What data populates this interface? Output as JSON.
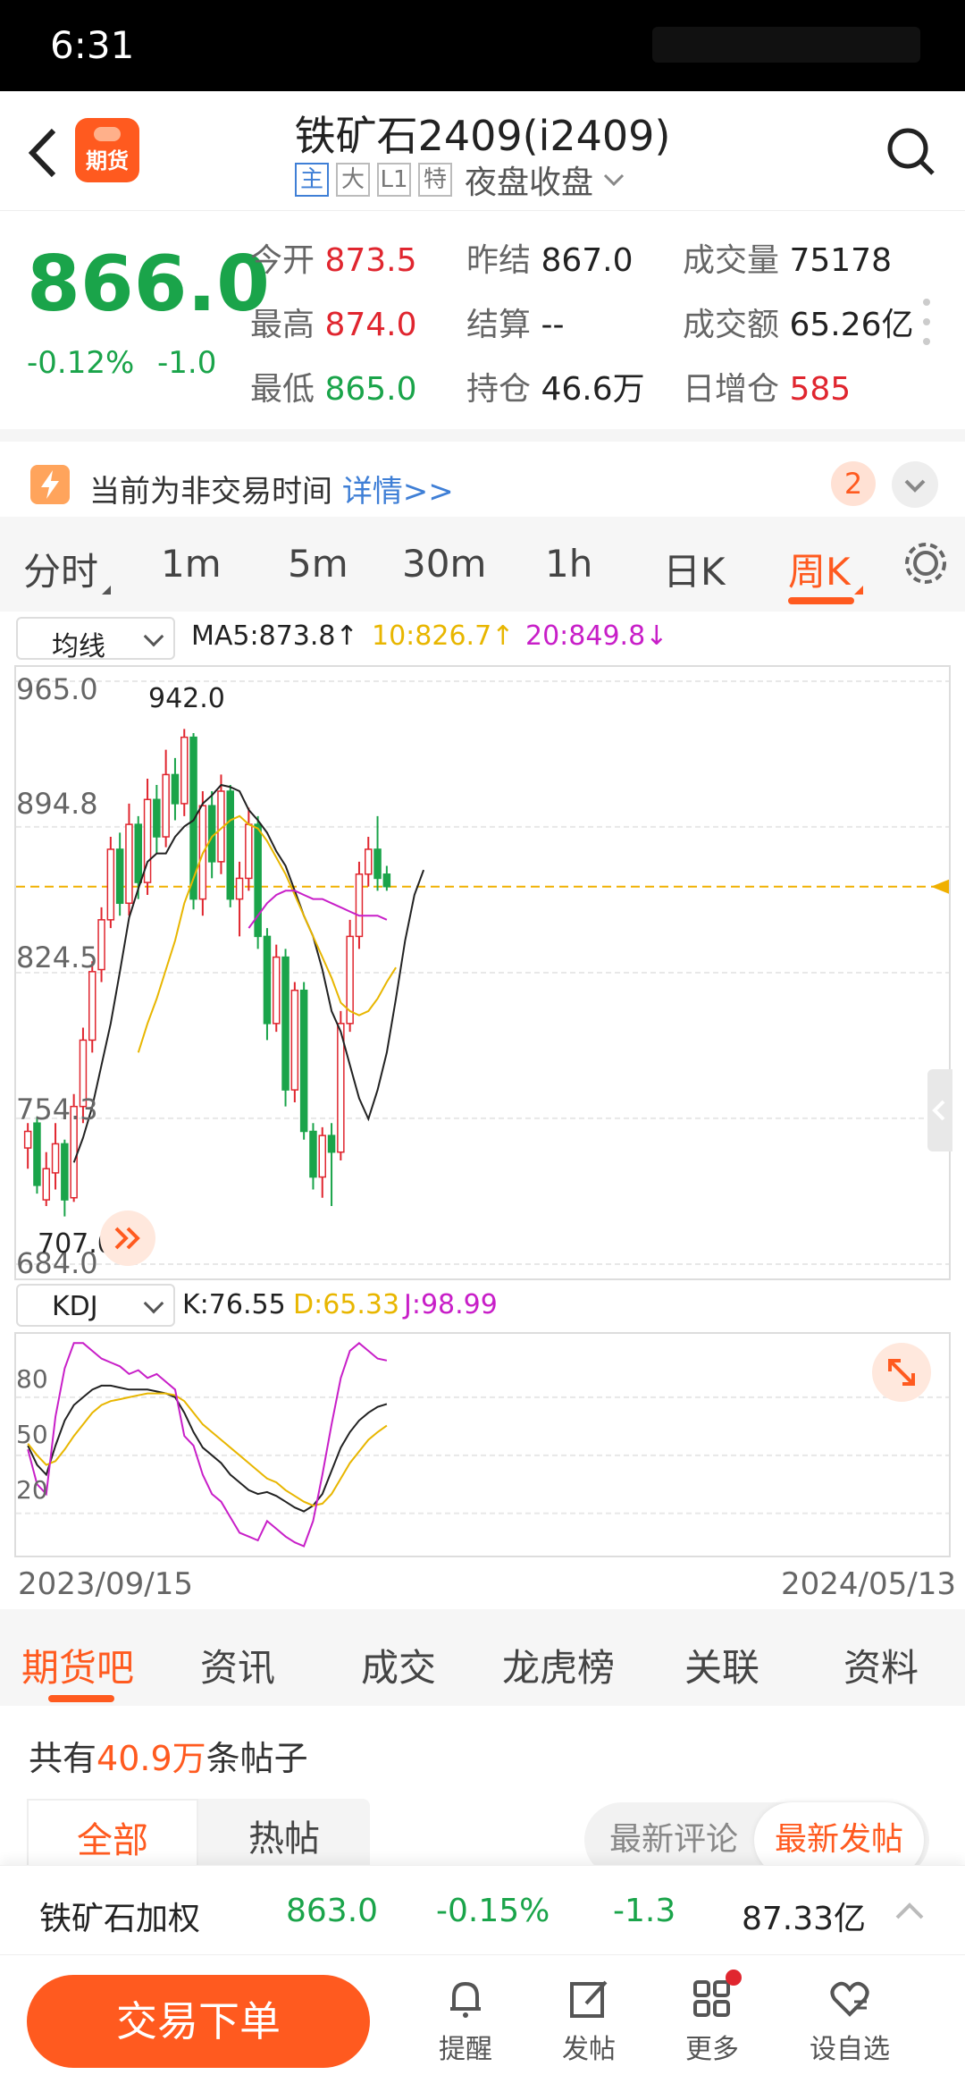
{
  "status": {
    "time": "6:31"
  },
  "header": {
    "logo_text": "期货",
    "title": "铁矿石2409(i2409)",
    "tags": [
      "主",
      "大",
      "L1",
      "特"
    ],
    "session": "夜盘收盘"
  },
  "quote": {
    "last": "866.0",
    "change_pct": "-0.12%",
    "change": "-1.0",
    "cells": [
      {
        "label": "今开",
        "value": "873.5",
        "color": "red"
      },
      {
        "label": "昨结",
        "value": "867.0",
        "color": "dark"
      },
      {
        "label": "成交量",
        "value": "75178",
        "color": "dark"
      },
      {
        "label": "最高",
        "value": "874.0",
        "color": "red"
      },
      {
        "label": "结算",
        "value": "--",
        "color": "dark"
      },
      {
        "label": "成交额",
        "value": "65.26亿",
        "color": "dark"
      },
      {
        "label": "最低",
        "value": "865.0",
        "color": "green"
      },
      {
        "label": "持仓",
        "value": "46.6万",
        "color": "dark"
      },
      {
        "label": "日增仓",
        "value": "585",
        "color": "red"
      }
    ]
  },
  "notice": {
    "text": "当前为非交易时间",
    "link": "详情>>",
    "badge": "2"
  },
  "period_tabs": [
    "分时",
    "1m",
    "5m",
    "30m",
    "1h",
    "日K",
    "周K"
  ],
  "active_period": "周K",
  "ma": {
    "selector": "均线",
    "ma5": "MA5:873.8↑",
    "ma10": "10:826.7↑",
    "ma20": "20:849.8↓",
    "colors": {
      "ma5": "#222222",
      "ma10": "#e8b600",
      "ma20": "#c81fc8"
    }
  },
  "chart_data": [
    {
      "type": "candlestick",
      "title": "",
      "ylim": [
        684.0,
        965.0
      ],
      "y_ticks": [
        "965.0",
        "894.8",
        "824.5",
        "754.3",
        "684.0"
      ],
      "high_label": "942.0",
      "low_label": "707.0",
      "current_price_line": 866.0,
      "candles": [
        {
          "o": 740,
          "c": 748,
          "h": 752,
          "l": 730
        },
        {
          "o": 752,
          "c": 722,
          "h": 755,
          "l": 718
        },
        {
          "o": 715,
          "c": 730,
          "h": 738,
          "l": 712
        },
        {
          "o": 728,
          "c": 742,
          "h": 752,
          "l": 720
        },
        {
          "o": 742,
          "c": 715,
          "h": 744,
          "l": 707
        },
        {
          "o": 716,
          "c": 760,
          "h": 766,
          "l": 714
        },
        {
          "o": 760,
          "c": 792,
          "h": 798,
          "l": 752
        },
        {
          "o": 792,
          "c": 825,
          "h": 830,
          "l": 786
        },
        {
          "o": 826,
          "c": 850,
          "h": 856,
          "l": 820
        },
        {
          "o": 850,
          "c": 884,
          "h": 890,
          "l": 846
        },
        {
          "o": 884,
          "c": 858,
          "h": 892,
          "l": 852
        },
        {
          "o": 858,
          "c": 896,
          "h": 906,
          "l": 852
        },
        {
          "o": 896,
          "c": 868,
          "h": 900,
          "l": 860
        },
        {
          "o": 868,
          "c": 908,
          "h": 918,
          "l": 862
        },
        {
          "o": 908,
          "c": 890,
          "h": 915,
          "l": 882
        },
        {
          "o": 890,
          "c": 920,
          "h": 932,
          "l": 885
        },
        {
          "o": 920,
          "c": 906,
          "h": 928,
          "l": 898
        },
        {
          "o": 906,
          "c": 938,
          "h": 942,
          "l": 900
        },
        {
          "o": 938,
          "c": 860,
          "h": 940,
          "l": 855
        },
        {
          "o": 860,
          "c": 905,
          "h": 912,
          "l": 852
        },
        {
          "o": 905,
          "c": 878,
          "h": 912,
          "l": 870
        },
        {
          "o": 878,
          "c": 912,
          "h": 920,
          "l": 872
        },
        {
          "o": 912,
          "c": 860,
          "h": 915,
          "l": 856
        },
        {
          "o": 860,
          "c": 870,
          "h": 878,
          "l": 842
        },
        {
          "o": 870,
          "c": 896,
          "h": 904,
          "l": 864
        },
        {
          "o": 896,
          "c": 842,
          "h": 900,
          "l": 836
        },
        {
          "o": 842,
          "c": 800,
          "h": 846,
          "l": 792
        },
        {
          "o": 800,
          "c": 832,
          "h": 838,
          "l": 796
        },
        {
          "o": 832,
          "c": 768,
          "h": 836,
          "l": 760
        },
        {
          "o": 768,
          "c": 816,
          "h": 820,
          "l": 762
        },
        {
          "o": 816,
          "c": 748,
          "h": 820,
          "l": 744
        },
        {
          "o": 748,
          "c": 726,
          "h": 752,
          "l": 720
        },
        {
          "o": 726,
          "c": 746,
          "h": 750,
          "l": 716
        },
        {
          "o": 746,
          "c": 738,
          "h": 752,
          "l": 712
        },
        {
          "o": 738,
          "c": 800,
          "h": 806,
          "l": 734
        },
        {
          "o": 800,
          "c": 842,
          "h": 850,
          "l": 796
        },
        {
          "o": 842,
          "c": 872,
          "h": 878,
          "l": 836
        },
        {
          "o": 872,
          "c": 884,
          "h": 890,
          "l": 866
        },
        {
          "o": 884,
          "c": 870,
          "h": 900,
          "l": 864
        },
        {
          "o": 872,
          "c": 866,
          "h": 876,
          "l": 864
        }
      ],
      "series": [
        {
          "name": "MA5",
          "start": 5,
          "values": [
            733,
            745,
            760,
            780,
            800,
            825,
            851,
            865,
            878,
            882,
            882,
            890,
            895,
            898,
            906,
            910,
            915,
            914,
            912,
            903,
            898,
            892,
            883,
            876,
            864,
            852,
            842,
            826,
            806,
            796,
            780,
            764,
            754,
            768,
            786,
            812,
            840,
            862,
            874
          ]
        },
        {
          "name": "10",
          "start": 12,
          "values": [
            786,
            800,
            812,
            826,
            840,
            858,
            870,
            882,
            890,
            894,
            898,
            900,
            896,
            894,
            888,
            880,
            872,
            862,
            852,
            842,
            832,
            822,
            810,
            806,
            804,
            806,
            812,
            820,
            827
          ]
        },
        {
          "name": "20",
          "start": 24,
          "values": [
            846,
            852,
            858,
            862,
            864,
            864,
            862,
            860,
            860,
            858,
            856,
            854,
            852,
            852,
            852,
            850
          ]
        }
      ]
    },
    {
      "type": "line",
      "title": "",
      "ylim": [
        0,
        110
      ],
      "y_ticks": [
        "80",
        "50",
        "20"
      ],
      "series": [
        {
          "name": "K",
          "values": [
            55,
            45,
            40,
            55,
            68,
            76,
            80,
            84,
            86,
            86,
            85,
            84,
            84,
            84,
            83,
            82,
            80,
            72,
            62,
            54,
            50,
            46,
            40,
            36,
            32,
            30,
            31,
            29,
            26,
            23,
            21,
            24,
            30,
            42,
            54,
            62,
            68,
            72,
            75,
            76.55
          ]
        },
        {
          "name": "D",
          "values": [
            56,
            50,
            45,
            47,
            53,
            60,
            66,
            72,
            76,
            78,
            79,
            80,
            81,
            82,
            82,
            82,
            81,
            78,
            72,
            66,
            62,
            58,
            54,
            50,
            46,
            42,
            38,
            36,
            32,
            29,
            26,
            24,
            25,
            30,
            38,
            46,
            52,
            58,
            62,
            65.33
          ]
        },
        {
          "name": "J",
          "values": [
            53,
            35,
            30,
            70,
            95,
            108,
            108,
            104,
            100,
            98,
            96,
            92,
            94,
            90,
            92,
            88,
            84,
            60,
            55,
            40,
            30,
            26,
            18,
            10,
            8,
            6,
            16,
            12,
            8,
            5,
            3,
            16,
            40,
            66,
            90,
            104,
            108,
            104,
            100,
            98.99
          ]
        }
      ]
    }
  ],
  "kdj": {
    "selector": "KDJ",
    "k": "K:76.55",
    "d": "D:65.33",
    "j": "J:98.99",
    "colors": {
      "k": "#222222",
      "d": "#e8b600",
      "j": "#c81fc8"
    }
  },
  "dates": {
    "start": "2023/09/15",
    "end": "2024/05/13"
  },
  "bottom_tabs": [
    "期货吧",
    "资讯",
    "成交",
    "龙虎榜",
    "关联",
    "资料"
  ],
  "posts": {
    "prefix": "共有",
    "count": "40.9万",
    "suffix": "条帖子",
    "filters": [
      "全部",
      "热帖"
    ],
    "sort": [
      "最新评论",
      "最新发帖"
    ]
  },
  "index_bar": {
    "name": "铁矿石加权",
    "price": "863.0",
    "pct": "-0.15%",
    "chg": "-1.3",
    "amount": "87.33亿"
  },
  "footer": {
    "trade": "交易下单",
    "icons": [
      "提醒",
      "发帖",
      "更多",
      "设自选"
    ]
  }
}
